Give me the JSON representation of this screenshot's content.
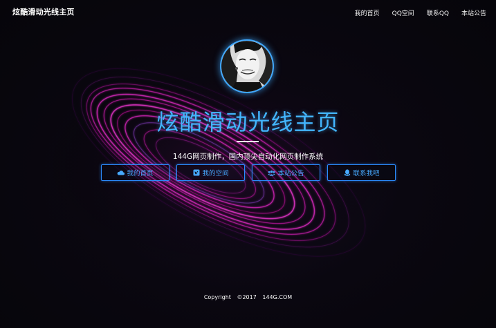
{
  "header": {
    "brand": "炫酷滑动光线主页",
    "nav": [
      "我的首页",
      "QQ空间",
      "联系QQ",
      "本站公告"
    ]
  },
  "hero": {
    "title": "炫酷滑动光线主页",
    "subtitle": "144G网页制作，国内顶尖自动化网页制作系统"
  },
  "buttons": [
    {
      "label": "我的首页",
      "icon": "cloud-icon"
    },
    {
      "label": "我的空间",
      "icon": "vimeo-icon"
    },
    {
      "label": "本站公告",
      "icon": "users-icon"
    },
    {
      "label": "联系我吧",
      "icon": "qq-icon"
    }
  ],
  "footer": {
    "text": "Copyright ©2017 144G.COM"
  },
  "colors": {
    "accent": "#43b6ff",
    "button_border": "#2b8cff",
    "swirl": "#d01fb4",
    "background": "#07050d"
  }
}
